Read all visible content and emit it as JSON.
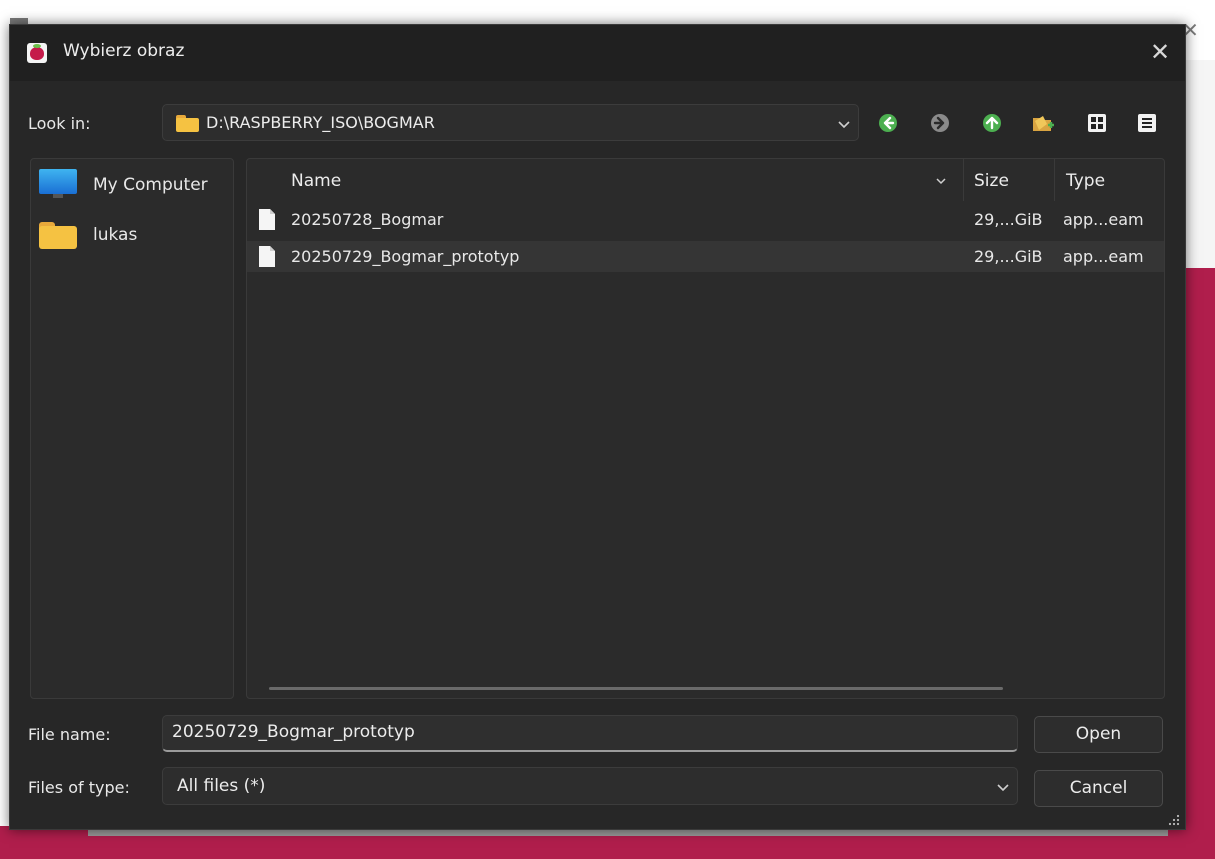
{
  "dialog": {
    "title": "Wybierz obraz",
    "close_glyph": "✕"
  },
  "toolbar": {
    "lookin_label": "Look in:",
    "lookin_path": "D:\\RASPBERRY_ISO\\BOGMAR",
    "icons": [
      "back-icon",
      "forward-icon",
      "up-folder-icon",
      "new-folder-icon",
      "list-view-icon",
      "detail-view-icon"
    ]
  },
  "sidebar": {
    "items": [
      {
        "label": "My Computer",
        "icon": "computer-icon"
      },
      {
        "label": "lukas",
        "icon": "folder-icon"
      }
    ]
  },
  "files": {
    "columns": [
      "Name",
      "Size",
      "Type"
    ],
    "rows": [
      {
        "name": "20250728_Bogmar",
        "size": "29,...GiB",
        "type": "app...eam"
      },
      {
        "name": "20250729_Bogmar_prototyp",
        "size": "29,...GiB",
        "type": "app...eam"
      }
    ]
  },
  "footer": {
    "filename_label": "File name:",
    "filename_value": "20250729_Bogmar_prototyp",
    "filetype_label": "Files of type:",
    "filetype_value": "All files (*)",
    "open_label": "Open",
    "cancel_label": "Cancel"
  },
  "colors": {
    "dialog_bg": "#272727",
    "accent_green": "#4caf50",
    "folder_yellow": "#f5c242",
    "background_crimson": "#b01e4c"
  }
}
